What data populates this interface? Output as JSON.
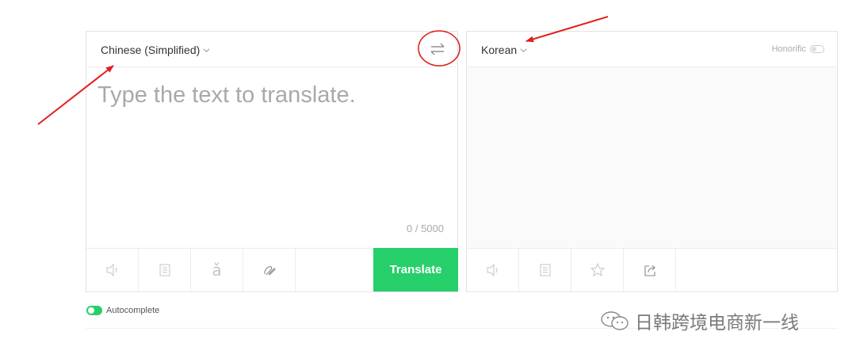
{
  "source": {
    "language": "Chinese (Simplified)",
    "placeholder": "Type the text to translate.",
    "char_count": "0 / 5000",
    "tools": [
      "speaker-icon",
      "dictionary-icon",
      "pinyin-icon",
      "handwriting-icon"
    ],
    "translate_label": "Translate"
  },
  "target": {
    "language": "Korean",
    "honorific_label": "Honorific",
    "tools": [
      "speaker-icon",
      "copy-icon",
      "star-icon",
      "share-icon"
    ]
  },
  "autocomplete_label": "Autocomplete",
  "watermark_text": "日韩跨境电商新一线",
  "pinyin_glyph": "ǎ",
  "colors": {
    "accent_green": "#27cf6a",
    "annotation_red": "#e02020"
  }
}
